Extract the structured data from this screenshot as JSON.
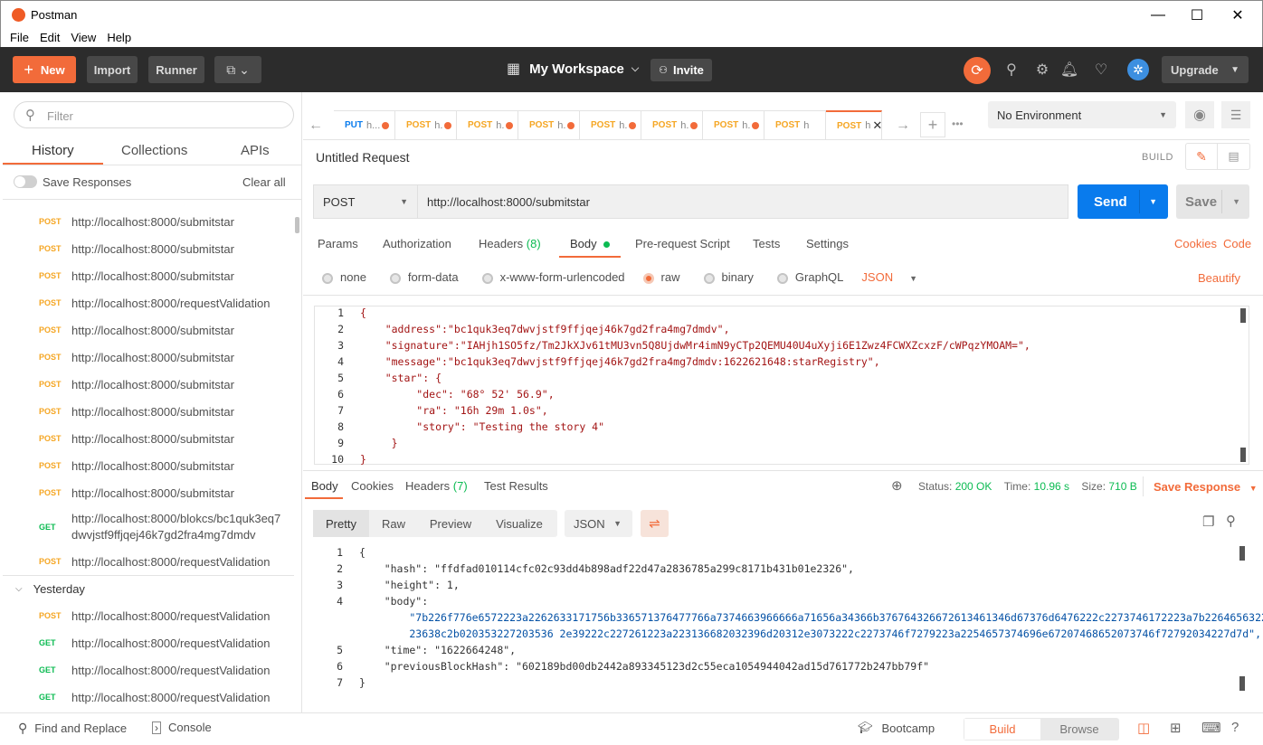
{
  "window": {
    "title": "Postman",
    "minimize": "—",
    "maximize": "☐",
    "close": "✕"
  },
  "menu": [
    "File",
    "Edit",
    "View",
    "Help"
  ],
  "header": {
    "new_label": "New",
    "import_label": "Import",
    "runner_label": "Runner",
    "workspace_label": "My Workspace",
    "invite_label": "Invite",
    "upgrade_label": "Upgrade",
    "accent": "#f26b3a"
  },
  "sidebar": {
    "filter_placeholder": "Filter",
    "tabs": [
      "History",
      "Collections",
      "APIs"
    ],
    "save_responses_label": "Save Responses",
    "clear_all_label": "Clear all",
    "history": [
      {
        "method": "POST",
        "url": "http://localhost:8000/submitstar"
      },
      {
        "method": "POST",
        "url": "http://localhost:8000/submitstar"
      },
      {
        "method": "POST",
        "url": "http://localhost:8000/submitstar"
      },
      {
        "method": "POST",
        "url": "http://localhost:8000/requestValidation"
      },
      {
        "method": "POST",
        "url": "http://localhost:8000/submitstar"
      },
      {
        "method": "POST",
        "url": "http://localhost:8000/submitstar"
      },
      {
        "method": "POST",
        "url": "http://localhost:8000/submitstar"
      },
      {
        "method": "POST",
        "url": "http://localhost:8000/submitstar"
      },
      {
        "method": "POST",
        "url": "http://localhost:8000/submitstar"
      },
      {
        "method": "POST",
        "url": "http://localhost:8000/submitstar"
      },
      {
        "method": "POST",
        "url": "http://localhost:8000/submitstar"
      }
    ],
    "get_item": {
      "method": "GET",
      "url_line1": "http://localhost:8000/blokcs/bc1quk3eq7",
      "url_line2": "dwvjstf9ffjqej46k7gd2fra4mg7dmdv"
    },
    "last_today": {
      "method": "POST",
      "url": "http://localhost:8000/requestValidation"
    },
    "yesterday_label": "Yesterday",
    "yesterday": [
      {
        "method": "POST",
        "url": "http://localhost:8000/requestValidation"
      },
      {
        "method": "GET",
        "url": "http://localhost:8000/requestValidation"
      },
      {
        "method": "GET",
        "url": "http://localhost:8000/requestValidation"
      },
      {
        "method": "GET",
        "url": "http://localhost:8000/requestValidation"
      }
    ]
  },
  "tabs": [
    {
      "method": "PUT",
      "label": "h..."
    },
    {
      "method": "POST",
      "label": "h."
    },
    {
      "method": "POST",
      "label": "h."
    },
    {
      "method": "POST",
      "label": "h."
    },
    {
      "method": "POST",
      "label": "h."
    },
    {
      "method": "POST",
      "label": "h."
    },
    {
      "method": "POST",
      "label": "h."
    },
    {
      "method": "POST",
      "label": "h"
    },
    {
      "method": "POST",
      "label": "h"
    }
  ],
  "environment": "No Environment",
  "request": {
    "title": "Untitled Request",
    "build_label": "BUILD",
    "method": "POST",
    "url": "http://localhost:8000/submitstar",
    "send_label": "Send",
    "save_label": "Save",
    "subtabs": {
      "params": "Params",
      "authorization": "Authorization",
      "headers": "Headers",
      "headers_count": "(8)",
      "body": "Body",
      "prerequest": "Pre-request Script",
      "tests": "Tests",
      "settings": "Settings"
    },
    "cookies_label": "Cookies",
    "code_label": "Code",
    "body_types": [
      "none",
      "form-data",
      "x-www-form-urlencoded",
      "raw",
      "binary",
      "GraphQL"
    ],
    "selected_body_type": "raw",
    "format": "JSON",
    "beautify_label": "Beautify",
    "body_lines": [
      "{",
      "    \"address\":\"bc1quk3eq7dwvjstf9ffjqej46k7gd2fra4mg7dmdv\",",
      "    \"signature\":\"IAHjh1SO5fz/Tm2JkXJv61tMU3vn5Q8UjdwMr4imN9yCTp2QEMU40U4uXyji6E1Zwz4FCWXZcxzF/cWPqzYMOAM=\",",
      "    \"message\":\"bc1quk3eq7dwvjstf9ffjqej46k7gd2fra4mg7dmdv:1622621648:starRegistry\",",
      "    \"star\": {",
      "         \"dec\": \"68° 52' 56.9\",",
      "         \"ra\": \"16h 29m 1.0s\",",
      "         \"story\": \"Testing the story 4\"",
      "     }",
      "}"
    ]
  },
  "response": {
    "tabs": {
      "body": "Body",
      "cookies": "Cookies",
      "headers": "Headers",
      "headers_count": "(7)",
      "test_results": "Test Results"
    },
    "status_label": "Status:",
    "status_value": "200 OK",
    "time_label": "Time:",
    "time_value": "10.96 s",
    "size_label": "Size:",
    "size_value": "710 B",
    "save_response_label": "Save Response",
    "view_modes": [
      "Pretty",
      "Raw",
      "Preview",
      "Visualize"
    ],
    "format": "JSON",
    "lines": [
      "{",
      "    \"hash\": \"ffdfad010114cfc02c93dd4b898adf22d47a2836785a299c8171b431b01e2326\",",
      "    \"height\": 1,",
      "    \"body\":",
      "        \"7b226f776e6572223a2262633171756b336571376477766a7374663966666a71656a34366b376764326672613461346d67376d6476222c2273746172223a7b22646563223a2",
      "        23638c2b020353227203536 2e39222c227261223a223136682032396d20312e3073222c2273746f7279223a2254657374696e67207468652073746f72792034227d7d\",",
      "    \"time\": \"1622664248\",",
      "    \"previousBlockHash\": \"602189bd00db2442a893345123d2c55eca1054944042ad15d761772b247bb79f\"",
      "}"
    ],
    "line_numbers": [
      "1",
      "2",
      "3",
      "4",
      "",
      "",
      "5",
      "6",
      "7"
    ]
  },
  "bottom": {
    "find_replace": "Find and Replace",
    "console": "Console",
    "bootcamp": "Bootcamp",
    "build": "Build",
    "browse": "Browse"
  }
}
